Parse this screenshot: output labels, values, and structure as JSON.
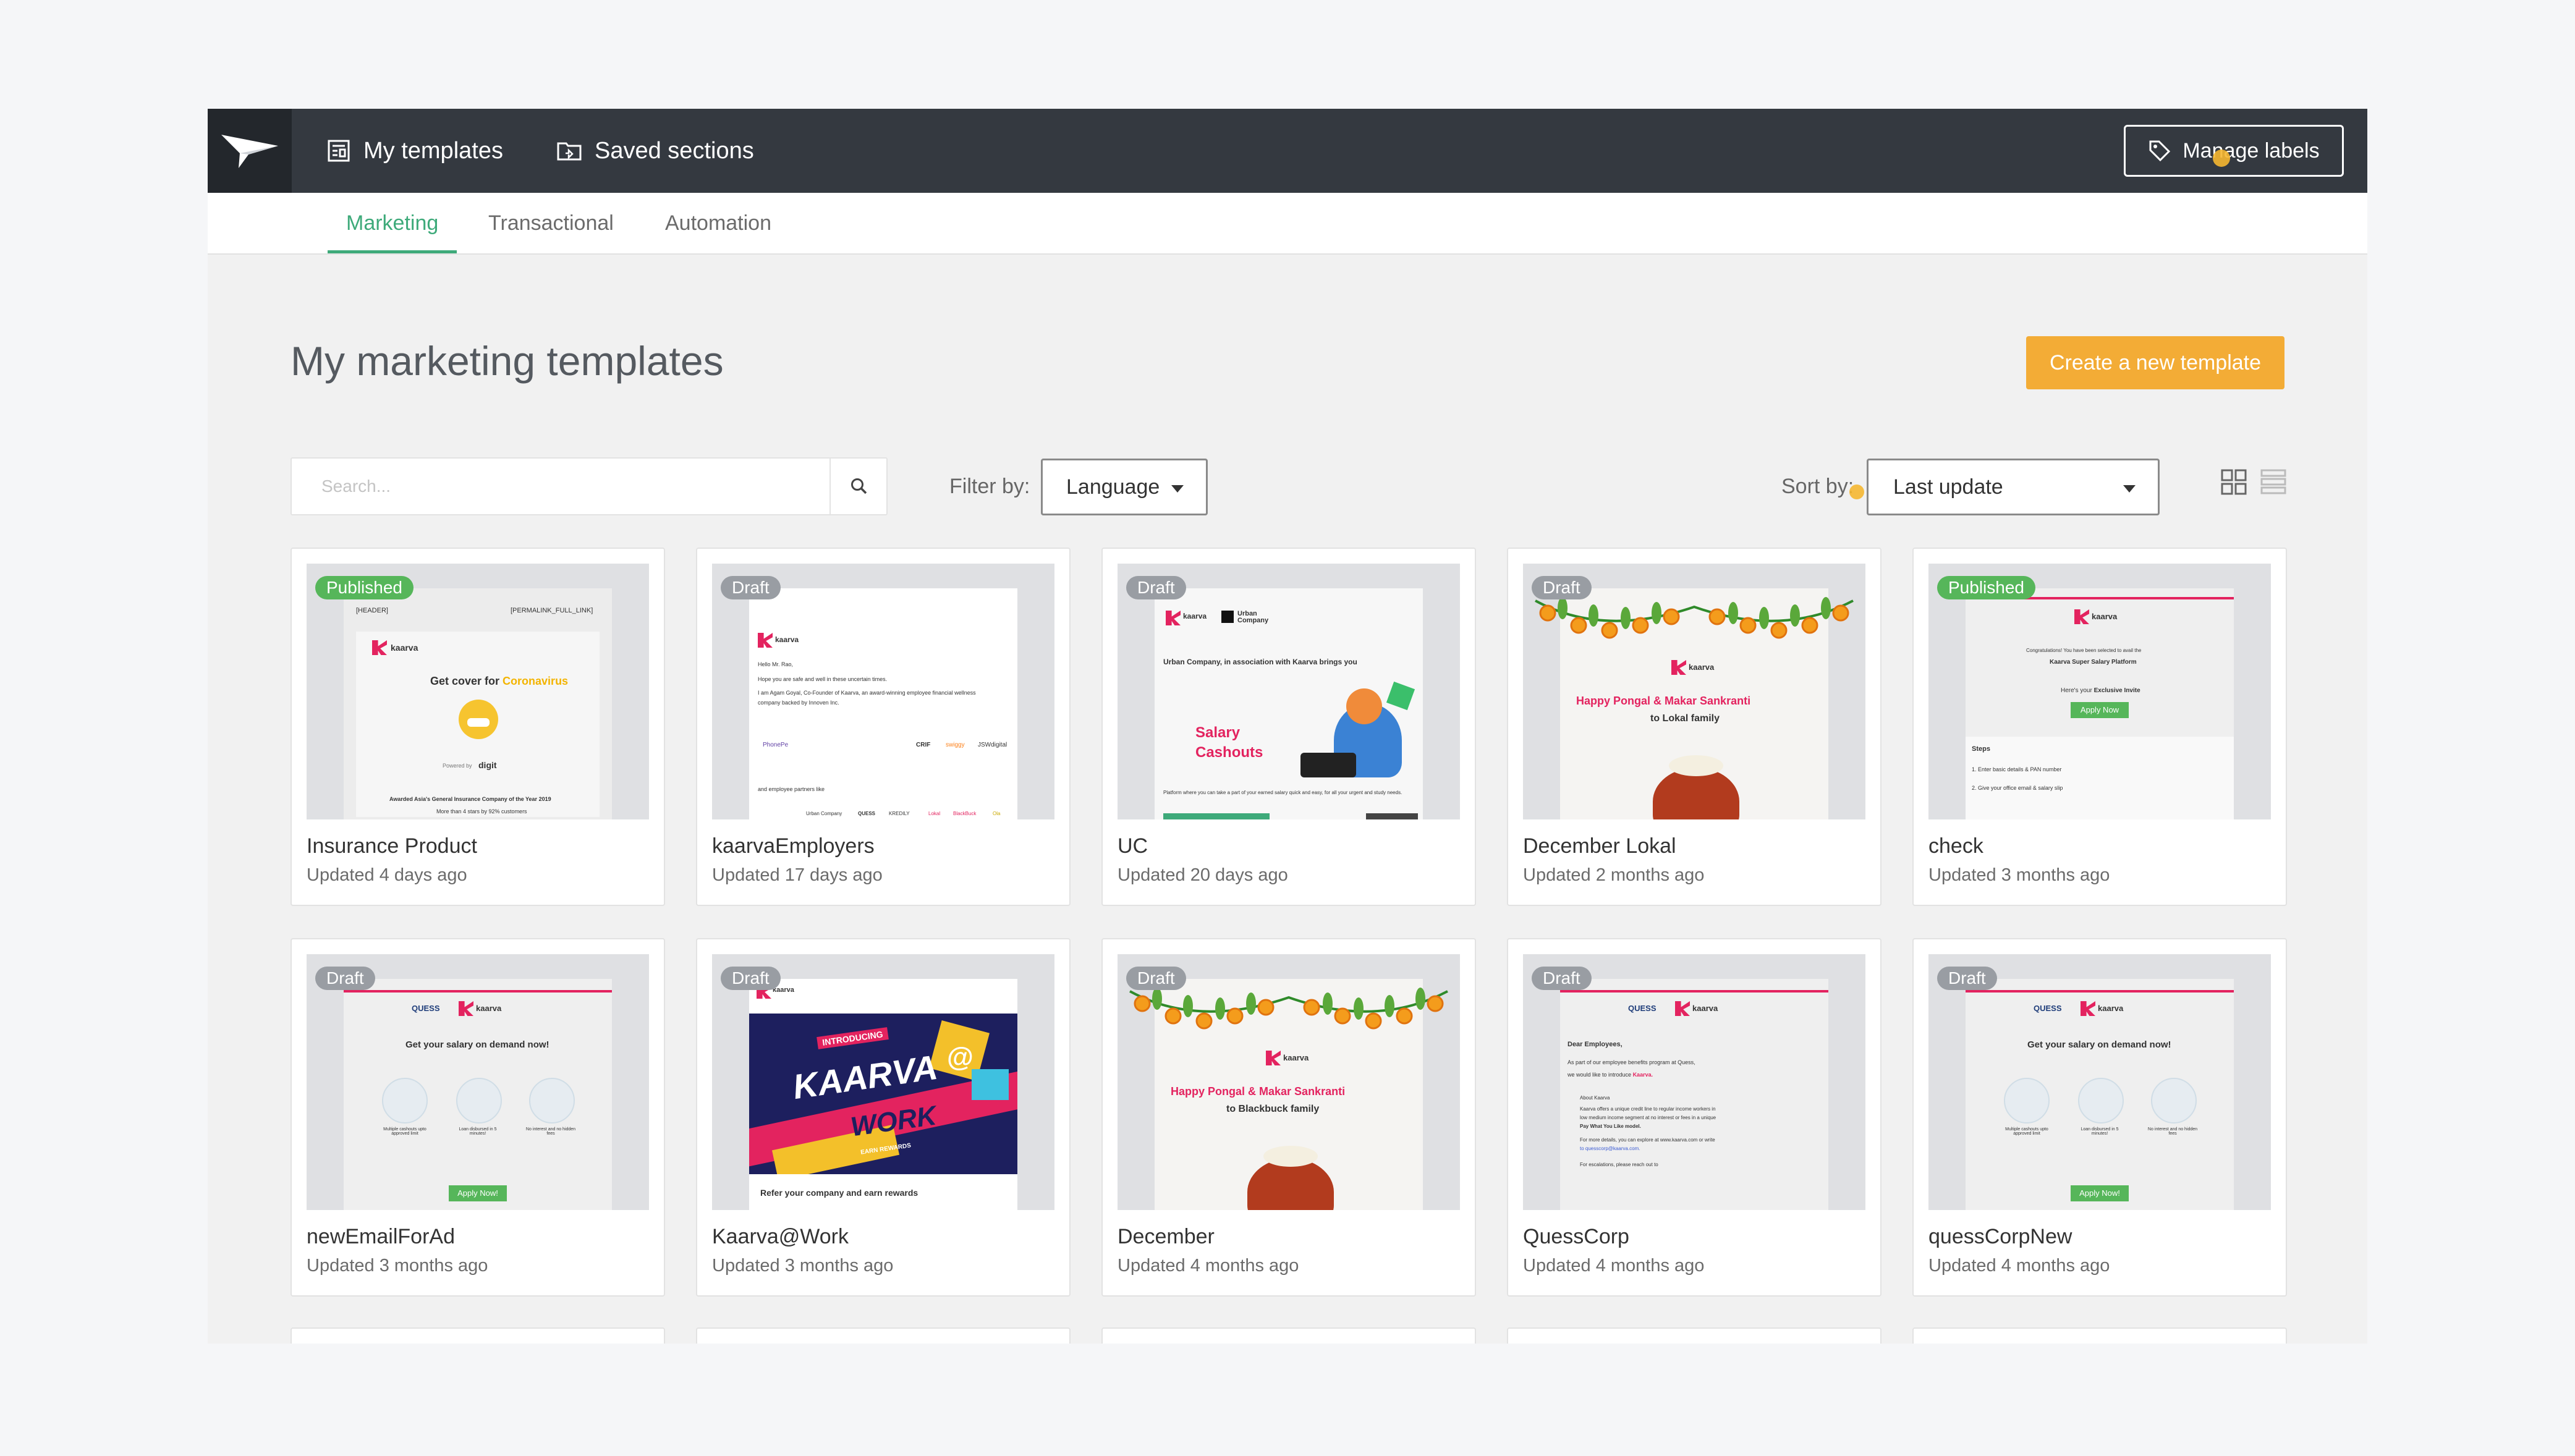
{
  "topbar": {
    "nav": [
      {
        "label": "My templates",
        "icon": "templates-icon"
      },
      {
        "label": "Saved sections",
        "icon": "folder-icon"
      }
    ],
    "manage_labels": "Manage labels"
  },
  "subtabs": [
    {
      "label": "Marketing",
      "active": true
    },
    {
      "label": "Transactional",
      "active": false
    },
    {
      "label": "Automation",
      "active": false
    }
  ],
  "page": {
    "title": "My marketing templates",
    "create_button": "Create a new template"
  },
  "toolbar": {
    "search_placeholder": "Search...",
    "filter_label": "Filter by:",
    "filter_value": "Language",
    "sort_label": "Sort by:",
    "sort_value": "Last update"
  },
  "cards": [
    {
      "name": "Insurance Product",
      "updated": "Updated 4 days ago",
      "status": "Published"
    },
    {
      "name": "kaarvaEmployers",
      "updated": "Updated 17 days ago",
      "status": "Draft"
    },
    {
      "name": "UC",
      "updated": "Updated 20 days ago",
      "status": "Draft"
    },
    {
      "name": "December Lokal",
      "updated": "Updated 2 months ago",
      "status": "Draft"
    },
    {
      "name": "check",
      "updated": "Updated 3 months ago",
      "status": "Published"
    },
    {
      "name": "newEmailForAd",
      "updated": "Updated 3 months ago",
      "status": "Draft"
    },
    {
      "name": "Kaarva@Work",
      "updated": "Updated 3 months ago",
      "status": "Draft"
    },
    {
      "name": "December",
      "updated": "Updated 4 months ago",
      "status": "Draft"
    },
    {
      "name": "QuessCorp",
      "updated": "Updated 4 months ago",
      "status": "Draft"
    },
    {
      "name": "quessCorpNew",
      "updated": "Updated 4 months ago",
      "status": "Draft"
    }
  ],
  "previews": {
    "insurance": {
      "header_left": "[HEADER]",
      "header_right": "[PERMALINK_FULL_LINK]",
      "brand": "kaarva",
      "headline": "Get cover for ",
      "headline_highlight": "Coronavirus",
      "powered": "Powered by",
      "partner": "digit",
      "award": "Awarded Asia's General Insurance Company of the Year 2019",
      "customers": "More than 4 stars by 92% customers"
    },
    "employers": {
      "brand": "kaarva",
      "greeting": "Hello Mr. Rao,",
      "line1": "Hope you are safe and well in these uncertain times.",
      "line2": "I am Agam Goyal, Co-Founder of Kaarva, an award-winning employee financial wellness",
      "line3": "company backed by Innoven Inc.",
      "line4": "and employee partners like",
      "logos1": [
        "PhonePe",
        "CRIF",
        "swiggy",
        "JSWdigital"
      ],
      "logos2": [
        "Urban Company",
        "QUESS",
        "KREDILY",
        "Lokal",
        "BlackBuck",
        "Ola"
      ]
    },
    "uc": {
      "brand": "kaarva",
      "partner": "Urban Company",
      "intro": "Urban Company, in association with Kaarva brings you",
      "headline1": "Salary",
      "headline2": "Cashouts",
      "body": "Platform where you can take a part of your earned salary quick and easy, for all your urgent and study needs."
    },
    "lokal": {
      "brand": "kaarva",
      "headline": "Happy Pongal & Makar Sankranti",
      "sub": "to Lokal family"
    },
    "check": {
      "brand": "kaarva",
      "congrats": "Congratulations! You have been selected to avail the",
      "platform": "Kaarva Super Salary Platform",
      "invite_pre": "Here's your ",
      "invite": "Exclusive Invite",
      "cta": "Apply Now",
      "steps_title": "Steps",
      "step1": "1. Enter basic details & PAN number",
      "step2": "2. Give your office email & salary slip"
    },
    "quess_ad": {
      "partner": "QUESS",
      "brand": "kaarva",
      "headline": "Get your salary on demand now!",
      "f1": "Multiple cashouts upto approved limit",
      "f2": "Loan disbursed in 5 minutes!",
      "f3": "No interest and no hidden fees",
      "cta": "Apply Now!"
    },
    "work": {
      "brand": "kaarva",
      "tag": "INTRODUCING",
      "line1": "KAARVA",
      "line2": "WORK",
      "ribbon": "EARN REWARDS",
      "footer": "Refer your company and earn rewards"
    },
    "december": {
      "brand": "kaarva",
      "headline": "Happy Pongal & Makar Sankranti",
      "sub": "to Blackbuck family"
    },
    "quesscorp": {
      "partner": "QUESS",
      "brand": "kaarva",
      "dear": "Dear Employees,",
      "p1": "As part of our employee benefits program at Quess,",
      "p2": "we would like to introduce ",
      "p2b": "Kaarva.",
      "about": "About Kaarva",
      "a1": "Kaarva offers a unique credit line to regular income workers in",
      "a2": "low medium income segment at no interest or fees in a unique",
      "a3": "Pay What You Like model.",
      "a4": "For more details, you can explore at www.kaarva.com or write",
      "a5": "to quesscorp@kaarva.com.",
      "a6": "For escalations, please reach out to"
    },
    "quess_new": {
      "partner": "QUESS",
      "brand": "kaarva",
      "headline": "Get your salary on demand now!",
      "f1": "Multiple cashouts upto approved limit",
      "f2": "Loan disbursed in 5 minutes!",
      "f3": "No interest and no hidden fees",
      "cta": "Apply Now!"
    }
  },
  "colors": {
    "accent_green": "#3eaa7a",
    "create_orange": "#f3ac36",
    "published": "#56b65a",
    "draft": "#999da3",
    "topbar": "#343940",
    "brand_pink": "#e3235f"
  }
}
